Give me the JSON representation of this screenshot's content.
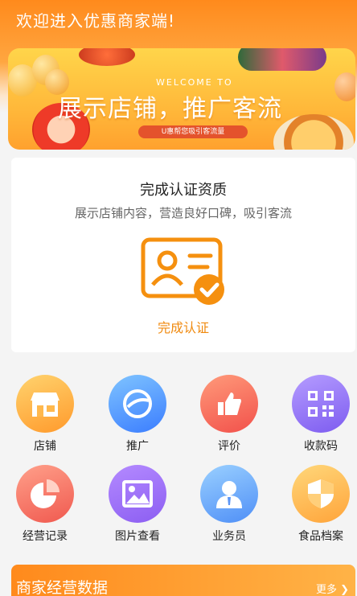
{
  "header": {
    "welcome": "欢迎进入优惠商家端!"
  },
  "banner": {
    "welcome_to": "WELCOME TO",
    "slogan": "展示店铺，推广客流",
    "pill": "U惠帮您吸引客流量"
  },
  "auth_card": {
    "title": "完成认证资质",
    "subtitle": "展示店铺内容，营造良好口碑，吸引客流",
    "action_label": "完成认证",
    "icon": "certificate-check-icon",
    "accent": "#f08a0f"
  },
  "grid": {
    "items": [
      {
        "label": "店铺",
        "icon": "store-icon"
      },
      {
        "label": "推广",
        "icon": "promotion-icon"
      },
      {
        "label": "评价",
        "icon": "thumbs-up-icon"
      },
      {
        "label": "收款码",
        "icon": "qr-code-icon"
      },
      {
        "label": "经营记录",
        "icon": "pie-chart-icon"
      },
      {
        "label": "图片查看",
        "icon": "image-icon"
      },
      {
        "label": "业务员",
        "icon": "salesperson-icon"
      },
      {
        "label": "食品档案",
        "icon": "shield-icon"
      }
    ]
  },
  "business": {
    "title": "商家经营数据",
    "more": "更多"
  },
  "colors": {
    "brand_orange": "#ff8a1c"
  }
}
